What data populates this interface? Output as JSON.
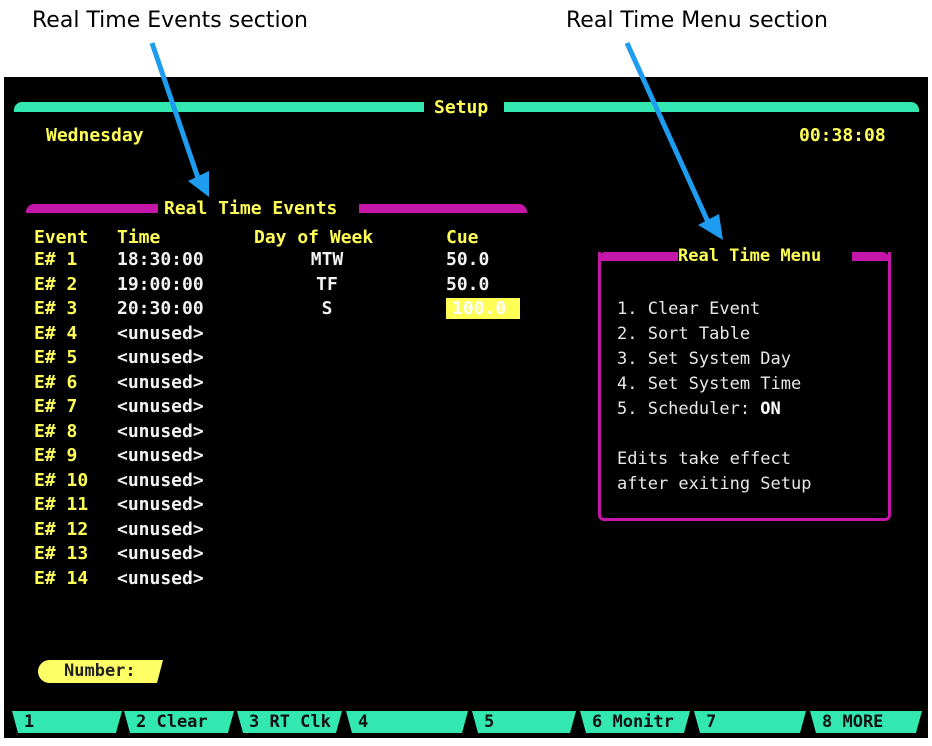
{
  "captions": {
    "left": "Real Time Events section",
    "right": "Real Time Menu section"
  },
  "header": {
    "title": "Setup",
    "day": "Wednesday",
    "clock": "00:38:08"
  },
  "events": {
    "title": "Real Time Events",
    "columns": [
      "Event",
      "Time",
      "Day of Week",
      "Cue"
    ],
    "rows": [
      {
        "id": "E#  1",
        "time": "18:30:00",
        "days": "MTW",
        "cue": "50.0"
      },
      {
        "id": "E#  2",
        "time": "19:00:00",
        "days": "TF",
        "cue": "50.0"
      },
      {
        "id": "E#  3",
        "time": "20:30:00",
        "days": "S",
        "cue": "100.0"
      },
      {
        "id": "E#  4",
        "time": "<unused>",
        "days": "",
        "cue": ""
      },
      {
        "id": "E#  5",
        "time": "<unused>",
        "days": "",
        "cue": ""
      },
      {
        "id": "E#  6",
        "time": "<unused>",
        "days": "",
        "cue": ""
      },
      {
        "id": "E#  7",
        "time": "<unused>",
        "days": "",
        "cue": ""
      },
      {
        "id": "E#  8",
        "time": "<unused>",
        "days": "",
        "cue": ""
      },
      {
        "id": "E#  9",
        "time": "<unused>",
        "days": "",
        "cue": ""
      },
      {
        "id": "E# 10",
        "time": "<unused>",
        "days": "",
        "cue": ""
      },
      {
        "id": "E# 11",
        "time": "<unused>",
        "days": "",
        "cue": ""
      },
      {
        "id": "E# 12",
        "time": "<unused>",
        "days": "",
        "cue": ""
      },
      {
        "id": "E# 13",
        "time": "<unused>",
        "days": "",
        "cue": ""
      },
      {
        "id": "E# 14",
        "time": "<unused>",
        "days": "",
        "cue": ""
      }
    ]
  },
  "menu": {
    "title": "Real Time Menu",
    "items": [
      "1. Clear Event",
      "2. Sort Table",
      "3. Set System Day",
      "4. Set System Time",
      "5. Scheduler: "
    ],
    "scheduler_value": "ON",
    "note_line1": "Edits take effect",
    "note_line2": "after exiting Setup"
  },
  "number_prompt": "Number:",
  "function_keys": [
    "1",
    "2 Clear",
    "3 RT Clk",
    "4",
    "5",
    "6 Monitr",
    "7",
    "8 MORE"
  ],
  "colors": {
    "screen": "#000000",
    "teal": "#33e8b0",
    "magenta": "#c416a8",
    "yellow": "#ffff55",
    "arrow": "#1e9cf0"
  }
}
